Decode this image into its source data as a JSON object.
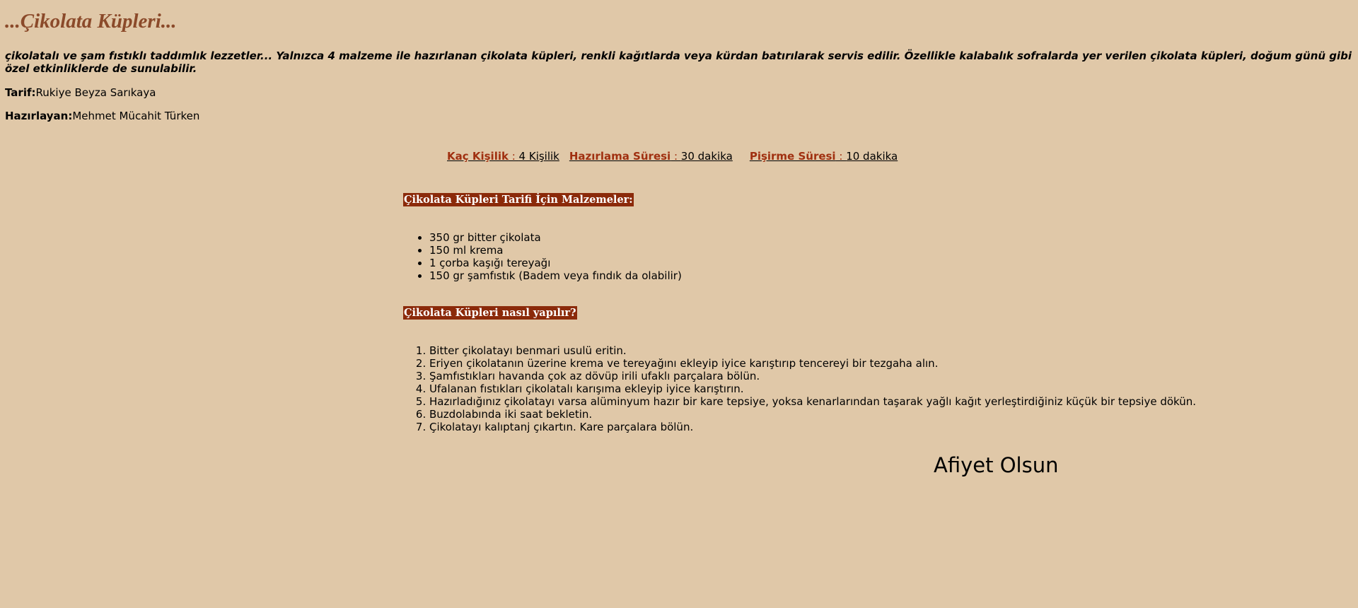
{
  "title": "...Çikolata Küpleri...",
  "intro": "çikolatalı ve şam fıstıklı taddımlık lezzetler... Yalnızca 4 malzeme ile hazırlanan çikolata küpleri, renkli kağıtlarda veya kürdan batırılarak servis edilir. Özellikle kalabalık sofralarda yer verilen çikolata küpleri, doğum günü gibi özel etkinliklerde de sunulabilir.",
  "recipe_by": {
    "label": "Tarif:",
    "value": "Rukiye Beyza Sarıkaya"
  },
  "prepared_by": {
    "label": "Hazırlayan:",
    "value": "Mehmet Mücahit Türken"
  },
  "info": [
    {
      "key": "Kaç Kişilik",
      "sep": " : ",
      "value": "4 Kişilik"
    },
    {
      "key": "Hazırlama Süresi",
      "sep": " : ",
      "value": "30 dakika"
    },
    {
      "key": "Pişirme Süresi",
      "sep": " : ",
      "value": "10 dakika"
    }
  ],
  "ingredients": {
    "heading": "Çikolata Küpleri Tarifi İçin Malzemeler:",
    "items": [
      "350 gr bitter çikolata",
      "150 ml krema",
      "1 çorba kaşığı tereyağı",
      "150 gr şamfıstık (Badem veya fındık da olabilir)"
    ]
  },
  "steps": {
    "heading": "Çikolata Küpleri nasıl yapılır?",
    "items": [
      "Bitter çikolatayı benmari usulü eritin.",
      "Eriyen çikolatanın üzerine krema ve tereyağını ekleyip iyice karıştırıp tencereyi bir tezgaha alın.",
      "Şamfıstıkları havanda çok az dövüp irili ufaklı parçalara bölün.",
      "Ufalanan fıstıkları çikolatalı karışıma ekleyip iyice karıştırın.",
      "Hazırladığınız çikolatayı varsa alüminyum hazır bir kare tepsiye, yoksa kenarlarından taşarak yağlı kağıt yerleştirdiğiniz küçük bir tepsiye dökün.",
      "Buzdolabında iki saat bekletin.",
      "Çikolatayı kalıptanj çıkartın. Kare parçalara bölün."
    ]
  },
  "closing": "Afiyet Olsun"
}
